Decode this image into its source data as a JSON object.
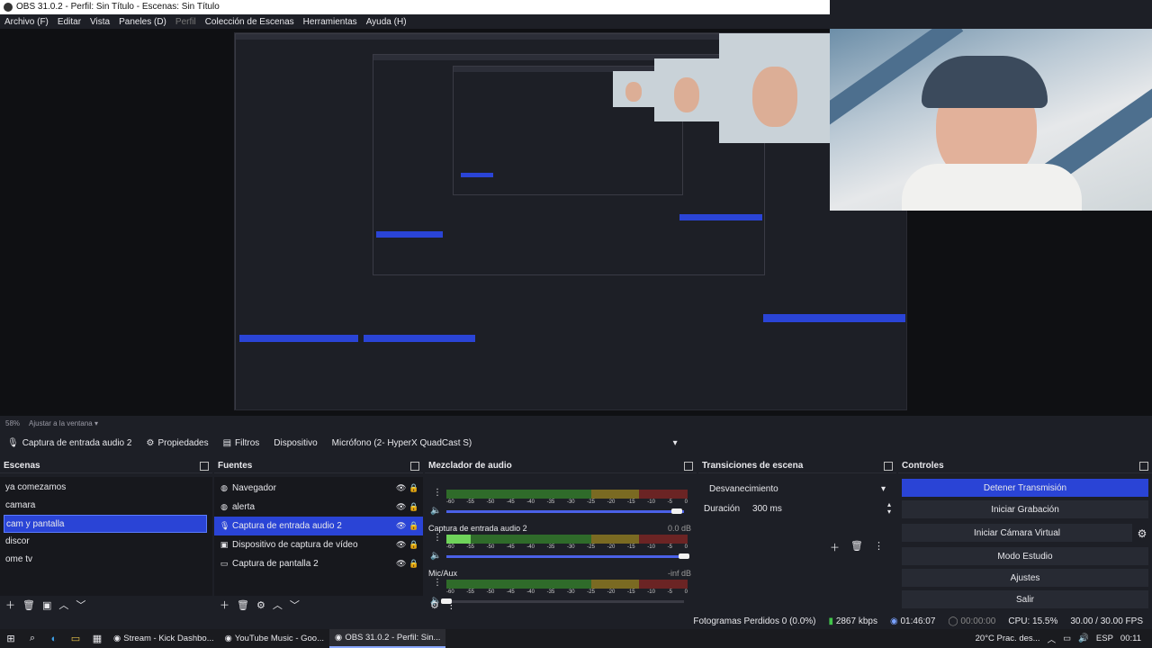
{
  "window": {
    "title": "OBS 31.0.2 - Perfil: Sin Título - Escenas: Sin Título"
  },
  "menu": [
    {
      "label": "Archivo (F)",
      "muted": false
    },
    {
      "label": "Editar",
      "muted": false
    },
    {
      "label": "Vista",
      "muted": false
    },
    {
      "label": "Paneles (D)",
      "muted": false
    },
    {
      "label": "Perfil",
      "muted": true
    },
    {
      "label": "Colección de Escenas",
      "muted": false
    },
    {
      "label": "Herramientas",
      "muted": false
    },
    {
      "label": "Ayuda (H)",
      "muted": false
    }
  ],
  "preview": {
    "zoom": "58%",
    "fit_label": "Ajustar a la ventana"
  },
  "source_toolbar": {
    "source_name": "Captura de entrada audio 2",
    "properties": "Propiedades",
    "filters": "Filtros",
    "device_label": "Dispositivo",
    "device_value": "Micrófono (2- HyperX QuadCast S)"
  },
  "scenes": {
    "title": "Escenas",
    "items": [
      {
        "label": "ya comezamos",
        "selected": false
      },
      {
        "label": "camara",
        "selected": false
      },
      {
        "label": "cam y pantalla",
        "selected": true
      },
      {
        "label": "discor",
        "selected": false
      },
      {
        "label": "ome tv",
        "selected": false
      }
    ]
  },
  "sources": {
    "title": "Fuentes",
    "items": [
      {
        "label": "Navegador",
        "icon": "globe-icon",
        "selected": false
      },
      {
        "label": "alerta",
        "icon": "globe-icon",
        "selected": false
      },
      {
        "label": "Captura de entrada audio 2",
        "icon": "microphone-icon",
        "selected": true
      },
      {
        "label": "Dispositivo de captura de vídeo",
        "icon": "camera-icon",
        "selected": false
      },
      {
        "label": "Captura de pantalla 2",
        "icon": "monitor-icon",
        "selected": false
      }
    ]
  },
  "mixer": {
    "title": "Mezclador de audio",
    "ticks": [
      "-60",
      "-55",
      "-50",
      "-45",
      "-40",
      "-35",
      "-30",
      "-25",
      "-20",
      "-15",
      "-10",
      "-5",
      "0"
    ],
    "channels": [
      {
        "name": "",
        "db": "",
        "level": 0,
        "fader": 0.97
      },
      {
        "name": "Captura de entrada audio 2",
        "db": "0.0 dB",
        "level": 0.1,
        "fader": 1.0
      },
      {
        "name": "Mic/Aux",
        "db": "-inf dB",
        "level": 0.0,
        "fader": 0.0
      }
    ]
  },
  "transitions": {
    "title": "Transiciones de escena",
    "selected": "Desvanecimiento",
    "duration_label": "Duración",
    "duration_value": "300 ms"
  },
  "controls": {
    "title": "Controles",
    "buttons": [
      {
        "label": "Detener Transmisión",
        "active": true
      },
      {
        "label": "Iniciar Grabación",
        "active": false
      },
      {
        "label": "Iniciar Cámara Virtual",
        "active": false
      },
      {
        "label": "Modo Estudio",
        "active": false
      },
      {
        "label": "Ajustes",
        "active": false
      },
      {
        "label": "Salir",
        "active": false
      }
    ]
  },
  "status": {
    "dropped_frames": "Fotogramas Perdidos 0 (0.0%)",
    "bitrate": "2867 kbps",
    "stream_time": "01:46:07",
    "rec_time": "00:00:00",
    "cpu": "CPU: 15.5%",
    "fps": "30.00 / 30.00 FPS"
  },
  "taskbar": {
    "apps": [
      {
        "label": "Stream - Kick Dashbo...",
        "active": false
      },
      {
        "label": "YouTube Music - Goo...",
        "active": false
      },
      {
        "label": "OBS 31.0.2 - Perfil: Sin...",
        "active": true
      }
    ],
    "weather": "20°C  Prac. des...",
    "lang": "ESP",
    "clock": "00:11"
  },
  "colors": {
    "accent": "#2a44d6",
    "panel": "#1d1f26",
    "meter_green": "#2f6b2a",
    "meter_yellow": "#7a6a22",
    "meter_red": "#6b2424"
  }
}
